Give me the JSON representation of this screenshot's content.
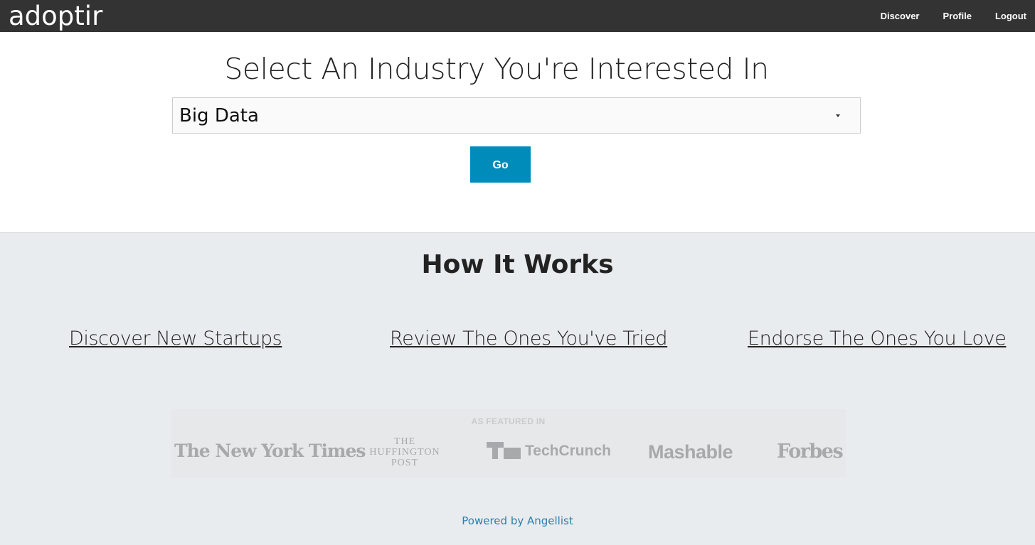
{
  "header": {
    "brand": "adoptir",
    "nav": [
      "Discover",
      "Profile",
      "Logout"
    ]
  },
  "hero": {
    "title": "Select An Industry You're Interested In",
    "select_value": "Big Data",
    "go_label": "Go"
  },
  "how_it_works": {
    "title": "How It Works",
    "steps": [
      "Discover New Startups",
      "Review The Ones You've Tried",
      "Endorse The Ones You Love"
    ]
  },
  "featured": {
    "label": "AS FEATURED IN",
    "logos": [
      "The New York Times",
      "THE HUFFINGTON POST",
      "TechCrunch",
      "Mashable",
      "Forbes"
    ]
  },
  "footer": {
    "powered_by": "Powered by Angellist"
  },
  "colors": {
    "topbar": "#333333",
    "button": "#008cba",
    "section_bg": "#e9ecee",
    "link": "#2a80b0"
  }
}
